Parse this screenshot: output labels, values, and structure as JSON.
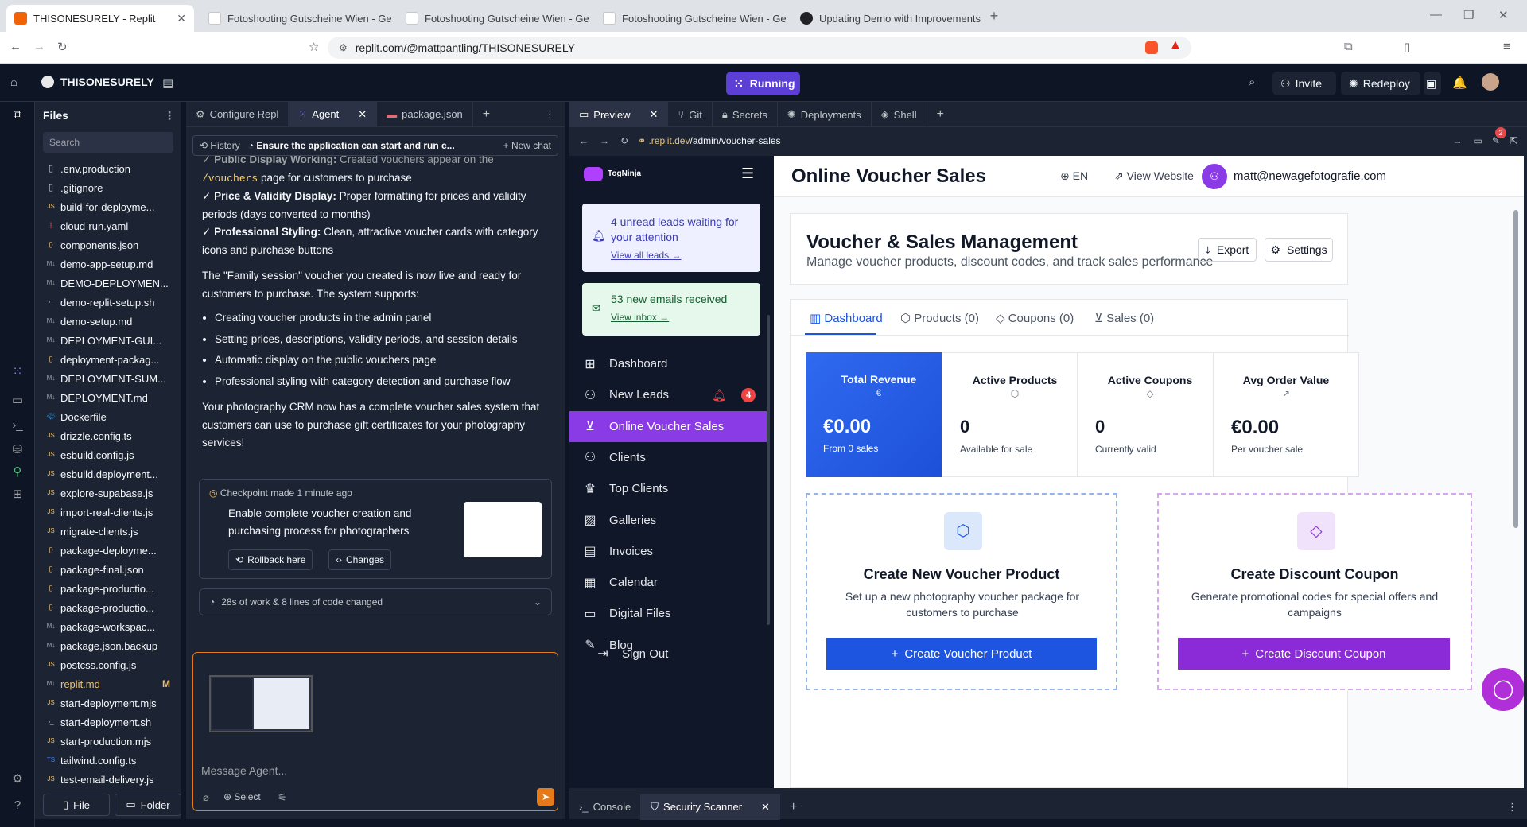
{
  "browser": {
    "tabs": [
      {
        "title": "THISONESURELY - Replit",
        "active": true
      },
      {
        "title": "Fotoshooting Gutscheine Wien - Ges"
      },
      {
        "title": "Fotoshooting Gutscheine Wien - Ges"
      },
      {
        "title": "Fotoshooting Gutscheine Wien - Ges"
      },
      {
        "title": "Updating Demo with Improvements"
      }
    ],
    "url": "replit.com/@mattpantling/THISONESURELY"
  },
  "replit": {
    "repl_name": "THISONESURELY",
    "status": "Running",
    "invite": "Invite",
    "redeploy": "Redeploy"
  },
  "files": {
    "title": "Files",
    "search_placeholder": "Search",
    "items": [
      {
        "name": ".env.production",
        "icon": "file"
      },
      {
        "name": ".gitignore",
        "icon": "file"
      },
      {
        "name": "build-for-deployme...",
        "icon": "js"
      },
      {
        "name": "cloud-run.yaml",
        "icon": "yaml"
      },
      {
        "name": "components.json",
        "icon": "json"
      },
      {
        "name": "demo-app-setup.md",
        "icon": "md"
      },
      {
        "name": "DEMO-DEPLOYMEN...",
        "icon": "md"
      },
      {
        "name": "demo-replit-setup.sh",
        "icon": "sh"
      },
      {
        "name": "demo-setup.md",
        "icon": "md"
      },
      {
        "name": "DEPLOYMENT-GUI...",
        "icon": "md"
      },
      {
        "name": "deployment-packag...",
        "icon": "json"
      },
      {
        "name": "DEPLOYMENT-SUM...",
        "icon": "md"
      },
      {
        "name": "DEPLOYMENT.md",
        "icon": "md"
      },
      {
        "name": "Dockerfile",
        "icon": "docker"
      },
      {
        "name": "drizzle.config.ts",
        "icon": "js"
      },
      {
        "name": "esbuild.config.js",
        "icon": "js"
      },
      {
        "name": "esbuild.deployment...",
        "icon": "js"
      },
      {
        "name": "explore-supabase.js",
        "icon": "js"
      },
      {
        "name": "import-real-clients.js",
        "icon": "js"
      },
      {
        "name": "migrate-clients.js",
        "icon": "js"
      },
      {
        "name": "package-deployme...",
        "icon": "json"
      },
      {
        "name": "package-final.json",
        "icon": "json"
      },
      {
        "name": "package-productio...",
        "icon": "json"
      },
      {
        "name": "package-productio...",
        "icon": "json"
      },
      {
        "name": "package-workspac...",
        "icon": "md"
      },
      {
        "name": "package.json.backup",
        "icon": "md"
      },
      {
        "name": "postcss.config.js",
        "icon": "js"
      },
      {
        "name": "replit.md",
        "icon": "md",
        "modified": "M"
      },
      {
        "name": "start-deployment.mjs",
        "icon": "js"
      },
      {
        "name": "start-deployment.sh",
        "icon": "sh"
      },
      {
        "name": "start-production.mjs",
        "icon": "js"
      },
      {
        "name": "tailwind.config.ts",
        "icon": "ts"
      },
      {
        "name": "test-email-delivery.js",
        "icon": "js"
      }
    ],
    "new_file": "File",
    "new_folder": "Folder"
  },
  "agent_panel": {
    "tabs": [
      "Configure Repl",
      "Agent",
      "package.json"
    ],
    "history": "History",
    "thread_title": "Ensure the application can start and run c...",
    "new_chat": "New chat",
    "lines": [
      {
        "prefix": "✓ ",
        "bold": "Public Display Working:",
        "text": " Created vouchers appear on the"
      },
      {
        "code": "/vouchers",
        "text": " page for customers to purchase"
      },
      {
        "prefix": "✓ ",
        "bold": "Price & Validity Display:",
        "text": " Proper formatting for prices and validity periods (days converted to months)"
      },
      {
        "prefix": "✓ ",
        "bold": "Professional Styling:",
        "text": " Clean, attractive voucher cards with category icons and purchase buttons"
      }
    ],
    "para1": "The \"Family session\" voucher you created is now live and ready for customers to purchase. The system supports:",
    "bullets": [
      "Creating voucher products in the admin panel",
      "Setting prices, descriptions, validity periods, and session details",
      "Automatic display on the public vouchers page",
      "Professional styling with category detection and purchase flow"
    ],
    "para2": "Your photography CRM now has a complete voucher sales system that customers can use to purchase gift certificates for your photography services!",
    "checkpoint": {
      "label": "Checkpoint made 1 minute ago",
      "desc": "Enable complete voucher creation and purchasing process for photographers",
      "rollback": "Rollback here",
      "changes": "Changes"
    },
    "work_summary": "28s of work & 8 lines of code changed",
    "message_placeholder": "Message Agent...",
    "select": "Select"
  },
  "preview": {
    "tabs": [
      "Preview",
      "Git",
      "Secrets",
      "Deployments",
      "Shell"
    ],
    "url_host": ".replit.dev",
    "url_path": "/admin/voucher-sales",
    "notification_count": "2"
  },
  "app": {
    "brand": "TogNinja",
    "alerts": {
      "leads_text": "4 unread leads waiting for your attention",
      "leads_link": "View all leads →",
      "emails_text": "53 new emails received",
      "emails_link": "View inbox →"
    },
    "nav": [
      {
        "label": "Dashboard",
        "icon": "dashboard-icon"
      },
      {
        "label": "New Leads",
        "icon": "user-plus-icon",
        "badge": "4"
      },
      {
        "label": "Online Voucher Sales",
        "icon": "cart-icon",
        "active": true
      },
      {
        "label": "Clients",
        "icon": "users-icon"
      },
      {
        "label": "Top Clients",
        "icon": "crown-icon"
      },
      {
        "label": "Galleries",
        "icon": "image-icon"
      },
      {
        "label": "Invoices",
        "icon": "invoice-icon"
      },
      {
        "label": "Calendar",
        "icon": "calendar-icon"
      },
      {
        "label": "Digital Files",
        "icon": "folder-icon"
      },
      {
        "label": "Blog",
        "icon": "blog-icon"
      }
    ],
    "sign_out": "Sign Out",
    "topbar": {
      "title": "Online Voucher Sales",
      "lang": "EN",
      "view_website": "View Website",
      "user_email": "matt@newagefotografie.com"
    },
    "card": {
      "title": "Voucher & Sales Management",
      "subtitle": "Manage voucher products, discount codes, and track sales performance",
      "export": "Export",
      "settings": "Settings"
    },
    "tabs": [
      "Dashboard",
      "Products (0)",
      "Coupons (0)",
      "Sales (0)"
    ],
    "stats": [
      {
        "label": "Total Revenue",
        "value": "€0.00",
        "sub": "From 0 sales",
        "icon": "€",
        "highlight": true
      },
      {
        "label": "Active Products",
        "value": "0",
        "sub": "Available for sale",
        "icon": "⬡"
      },
      {
        "label": "Active Coupons",
        "value": "0",
        "sub": "Currently valid",
        "icon": "◇"
      },
      {
        "label": "Avg Order Value",
        "value": "€0.00",
        "sub": "Per voucher sale",
        "icon": "↗"
      }
    ],
    "actions": [
      {
        "title": "Create New Voucher Product",
        "desc": "Set up a new photography voucher package for customers to purchase",
        "button": "Create Voucher Product"
      },
      {
        "title": "Create Discount Coupon",
        "desc": "Generate promotional codes for special offers and campaigns",
        "button": "Create Discount Coupon"
      }
    ]
  },
  "bottom_tabs": [
    "Console",
    "Security Scanner"
  ],
  "colors": {
    "replit_bg": "#0e1525",
    "panel_bg": "#1c2333",
    "running": "#5c3fd6",
    "active_nav": "#8a3be6",
    "primary_blue": "#1d55e0",
    "purple": "#8b2bd8"
  }
}
